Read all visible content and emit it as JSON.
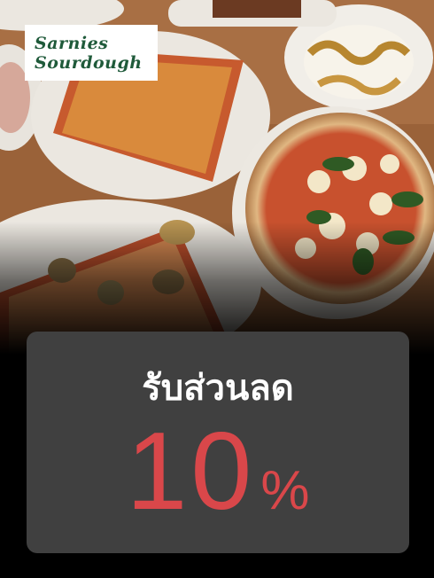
{
  "logo": {
    "line1": "Sarnies",
    "line2": "Sourdough"
  },
  "photo": {
    "subject": "food-photo"
  },
  "promo": {
    "headline": "รับส่วนลด",
    "value": "10",
    "unit": "%"
  },
  "colors": {
    "background": "#000000",
    "card": "#404040",
    "accent": "#d9474a",
    "logo_text": "#1f5a3a",
    "headline_text": "#ffffff"
  }
}
